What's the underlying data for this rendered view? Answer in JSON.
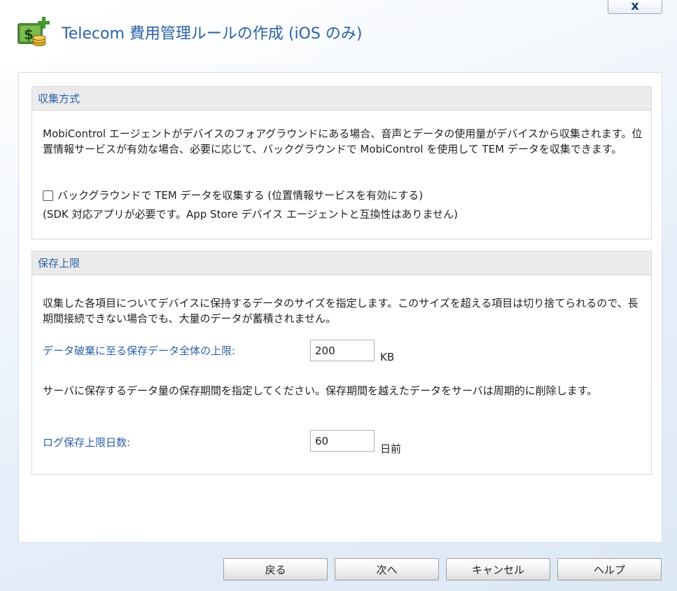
{
  "window": {
    "title": "Telecom 費用管理ルールの作成 (iOS のみ)",
    "close_label": "x",
    "title_icon": "money-plus-icon"
  },
  "collection": {
    "header": "収集方式",
    "description": "MobiControl エージェントがデバイスのフォアグラウンドにある場合、音声とデータの使用量がデバイスから収集されます。位置情報サービスが有効な場合、必要に応じて、バックグラウンドで MobiControl を使用して TEM データを収集できます。",
    "checkbox_label": "バックグラウンドで TEM データを収集する (位置情報サービスを有効にする)",
    "checkbox_checked": false,
    "note": "(SDK 対応アプリが必要です。App Store デバイス エージェントと互換性はありません)"
  },
  "retention": {
    "header": "保存上限",
    "description1": "収集した各項目についてデバイスに保持するデータのサイズを指定します。このサイズを超える項目は切り捨てられるので、長期間接続できない場合でも、大量のデータが蓄積されません。",
    "size_label": "データ破棄に至る保存データ全体の上限:",
    "size_value": "200",
    "size_unit": "KB",
    "description2": "サーバに保存するデータ量の保存期間を指定してください。保存期間を越えたデータをサーバは周期的に削除します。",
    "days_label": "ログ保存上限日数:",
    "days_value": "60",
    "days_unit": "日前"
  },
  "footer": {
    "back": "戻る",
    "next": "次へ",
    "cancel": "キャンセル",
    "help": "ヘルプ"
  },
  "colors": {
    "accent_text": "#2a61a8",
    "section_header_bg": "#ebebeb"
  }
}
